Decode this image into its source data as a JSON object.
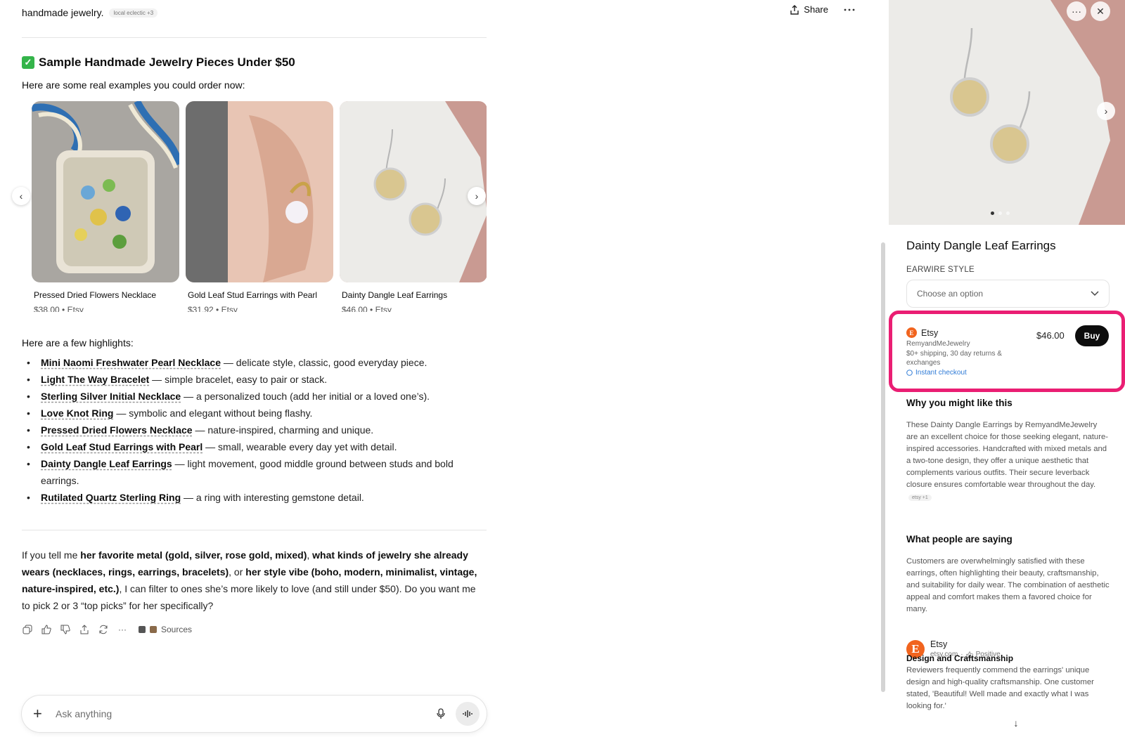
{
  "top_actions": {
    "share_label": "Share"
  },
  "intro": {
    "text_tail": "handmade jewelry.",
    "chip": "local eclectic +3"
  },
  "section": {
    "heading": "Sample Handmade Jewelry Pieces Under $50",
    "subtitle": "Here are some real examples you could order now:"
  },
  "products": [
    {
      "title": "Pressed Dried Flowers Necklace",
      "meta": "$38.00 • Etsy"
    },
    {
      "title": "Gold Leaf Stud Earrings with Pearl",
      "meta": "$31.92 • Etsy"
    },
    {
      "title": "Dainty Dangle Leaf Earrings",
      "meta": "$46.00 • Etsy"
    }
  ],
  "highlights": {
    "intro": "Here are a few highlights:",
    "items": [
      {
        "name": "Mini Naomi Freshwater Pearl Necklace",
        "desc": " — delicate style, classic, good everyday piece."
      },
      {
        "name": "Light The Way Bracelet",
        "desc": " — simple bracelet, easy to pair or stack."
      },
      {
        "name": "Sterling Silver Initial Necklace",
        "desc": " — a personalized touch (add her initial or a loved one’s)."
      },
      {
        "name": "Love Knot Ring",
        "desc": " — symbolic and elegant without being flashy."
      },
      {
        "name": "Pressed Dried Flowers Necklace",
        "desc": " — nature-inspired, charming and unique."
      },
      {
        "name": "Gold Leaf Stud Earrings with Pearl",
        "desc": " — small, wearable every day yet with detail."
      },
      {
        "name": "Dainty Dangle Leaf Earrings",
        "desc": " — light movement, good middle ground between studs and bold earrings."
      },
      {
        "name": "Rutilated Quartz Sterling Ring",
        "desc": " — a ring with interesting gemstone detail."
      }
    ]
  },
  "closing": {
    "p1": "If you tell me ",
    "b1": "her favorite metal (gold, silver, rose gold, mixed)",
    "p2": ", ",
    "b2": "what kinds of jewelry she already wears (necklaces, rings, earrings, bracelets)",
    "p3": ", or ",
    "b3": "her style vibe (boho, modern, minimalist, vintage, nature-inspired, etc.)",
    "p4": ", I can filter to ones she’s more likely to love (and still under $50). Do you want me to pick 2 or 3 “top picks” for her specifically?"
  },
  "message_actions": {
    "sources_label": "Sources"
  },
  "composer": {
    "placeholder": "Ask anything"
  },
  "panel": {
    "title": "Dainty Dangle Leaf Earrings",
    "option_label": "EARWIRE STYLE",
    "option_placeholder": "Choose an option",
    "offer": {
      "merchant": "Etsy",
      "seller": "RemyandMeJewelry",
      "shipping": "$0+ shipping, 30 day returns & exchanges",
      "checkout": "Instant checkout",
      "price": "$46.00",
      "buy_label": "Buy",
      "highlight_color": "#ea1e73"
    },
    "why": {
      "title": "Why you might like this",
      "body": "These Dainty Dangle Earrings by RemyandMeJewelry are an excellent choice for those seeking elegant, nature-inspired accessories. Handcrafted with mixed metals and a two-tone design, they offer a unique aesthetic that complements various outfits. Their secure leverback closure ensures comfortable wear throughout the day.",
      "chip": "etsy +1"
    },
    "reviews": {
      "title": "What people are saying",
      "body": "Customers are overwhelmingly satisfied with these earrings, often highlighting their beauty, craftsmanship, and suitability for daily wear. The combination of aesthetic appeal and comfort makes them a favored choice for many.",
      "source_name": "Etsy",
      "source_domain": "etsy.com",
      "sentiment": "Positive",
      "topic_title": "Design and Craftsmanship",
      "topic_body": "Reviewers frequently commend the earrings' unique design and high-quality craftsmanship. One customer stated, 'Beautiful! Well made and exactly what I was looking for.'"
    }
  }
}
